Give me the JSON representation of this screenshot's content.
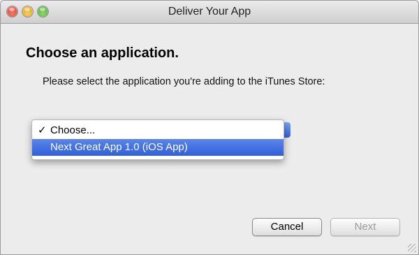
{
  "window": {
    "title": "Deliver Your App",
    "controls": [
      "close-button",
      "minimize-button",
      "zoom-button"
    ]
  },
  "main": {
    "heading": "Choose an application.",
    "instructions": "Please select the application you're adding to the iTunes Store:"
  },
  "popup": {
    "items": [
      {
        "label": "Choose...",
        "check": "✓",
        "selected": true
      },
      {
        "label": "Next Great App 1.0 (iOS App)",
        "check": "",
        "highlighted": true
      }
    ]
  },
  "buttons": {
    "cancel": "Cancel",
    "next": "Next"
  },
  "colors": {
    "highlight": "#3466dd",
    "window_bg": "#ececec",
    "disabled_text": "#9a9a9a"
  }
}
